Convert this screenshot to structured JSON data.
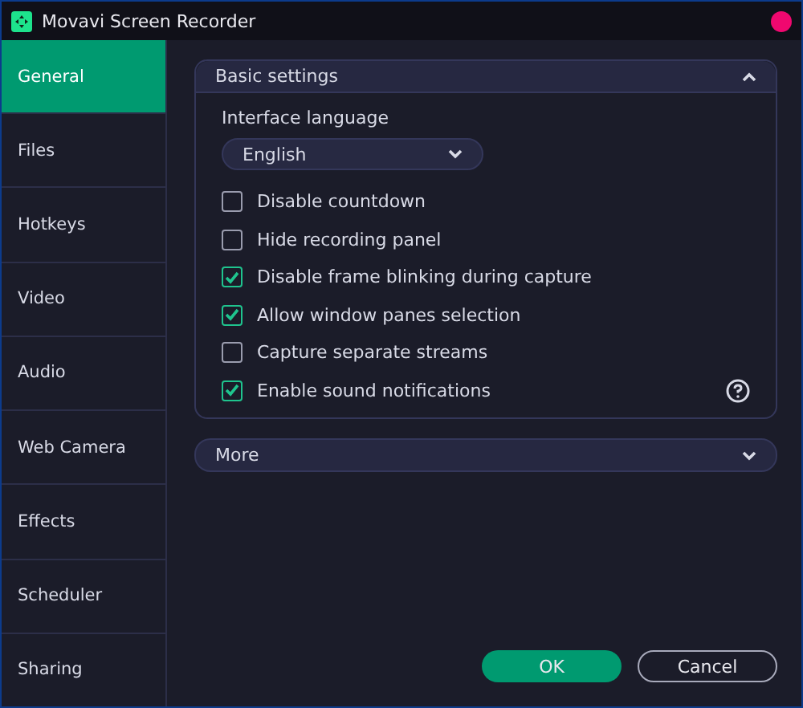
{
  "window": {
    "title": "Movavi Screen Recorder"
  },
  "sidebar": {
    "items": [
      {
        "label": "General",
        "selected": true
      },
      {
        "label": "Files",
        "selected": false
      },
      {
        "label": "Hotkeys",
        "selected": false
      },
      {
        "label": "Video",
        "selected": false
      },
      {
        "label": "Audio",
        "selected": false
      },
      {
        "label": "Web Camera",
        "selected": false
      },
      {
        "label": "Effects",
        "selected": false
      },
      {
        "label": "Scheduler",
        "selected": false
      },
      {
        "label": "Sharing",
        "selected": false
      }
    ]
  },
  "basic_settings": {
    "title": "Basic settings",
    "expanded": true,
    "language_label": "Interface language",
    "language_value": "English",
    "options": [
      {
        "label": "Disable countdown",
        "checked": false
      },
      {
        "label": "Hide recording panel",
        "checked": false
      },
      {
        "label": "Disable frame blinking during capture",
        "checked": true
      },
      {
        "label": "Allow window panes selection",
        "checked": true
      },
      {
        "label": "Capture separate streams",
        "checked": false
      },
      {
        "label": "Enable sound notifications",
        "checked": true
      }
    ]
  },
  "more": {
    "title": "More",
    "expanded": false
  },
  "buttons": [
    {
      "label": "OK",
      "kind": "primary"
    },
    {
      "label": "Cancel",
      "kind": "secondary"
    }
  ]
}
